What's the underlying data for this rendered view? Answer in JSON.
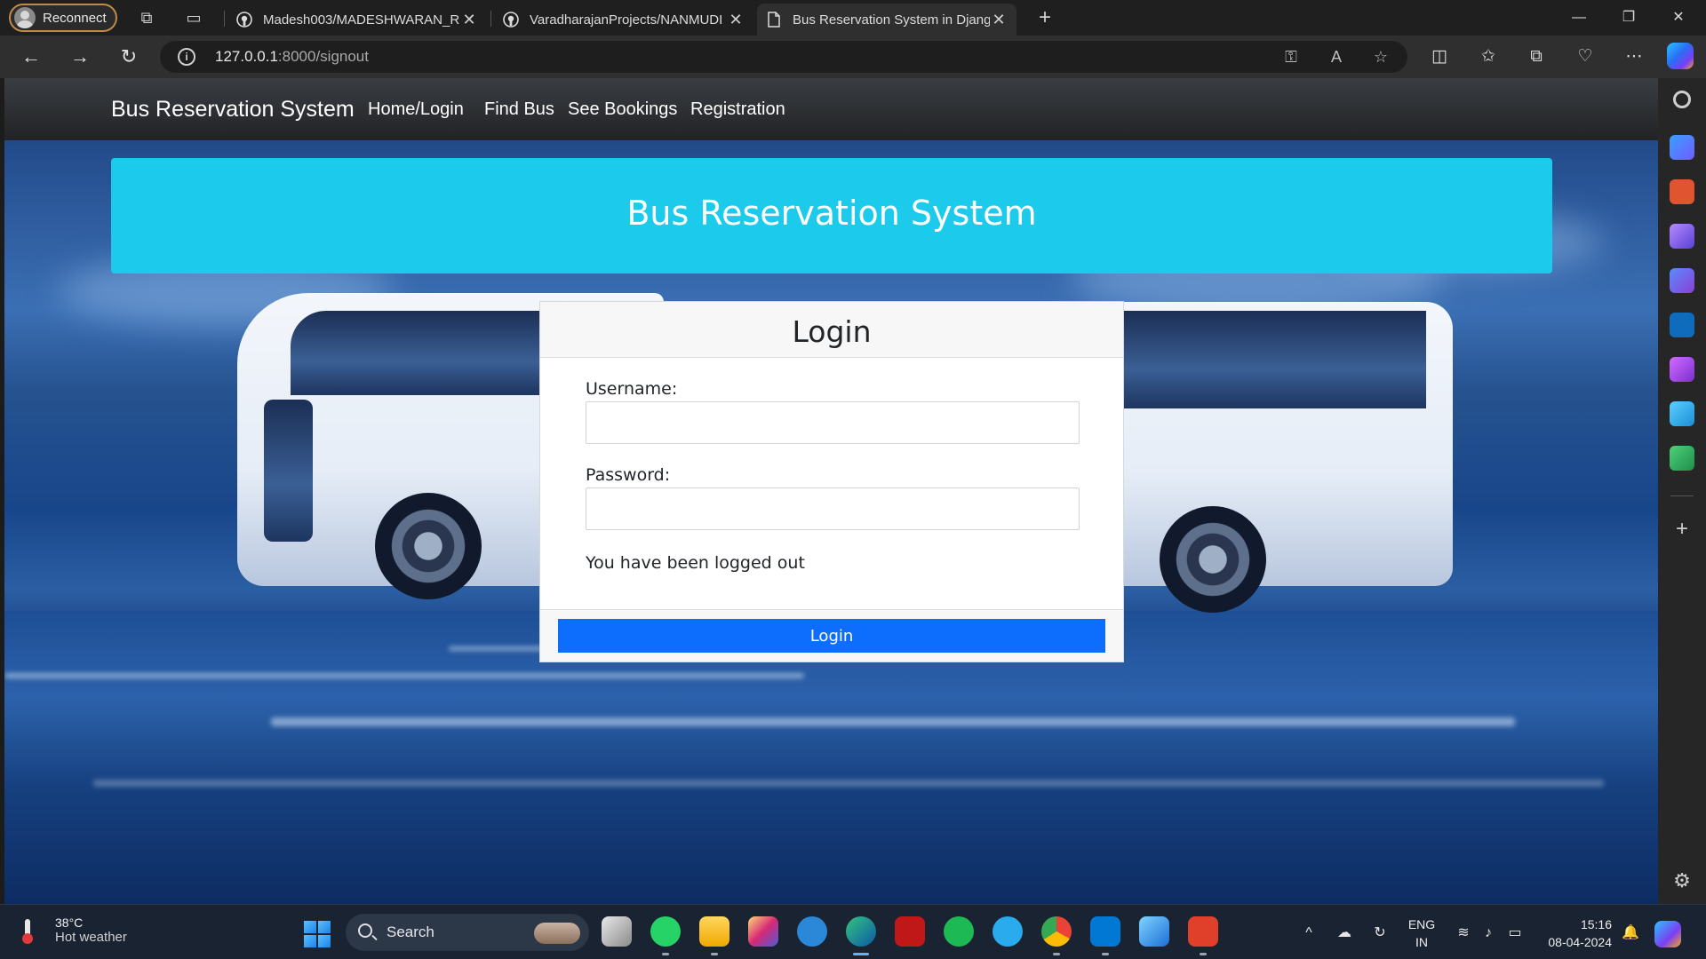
{
  "browser": {
    "profile_label": "Reconnect",
    "tabs": [
      {
        "title": "Madesh003/MADESHWARAN_R",
        "icon": "github-icon"
      },
      {
        "title": "VaradharajanProjects/NANMUDI",
        "icon": "github-icon"
      },
      {
        "title": "Bus Reservation System in Django",
        "icon": "document-icon",
        "active": true
      }
    ],
    "url_host": "127.0.0.1",
    "url_path": ":8000/signout"
  },
  "site": {
    "brand": "Bus Reservation System",
    "nav": [
      "Home/Login",
      "Find Bus",
      "See Bookings",
      "Registration"
    ],
    "banner_title": "Bus Reservation System"
  },
  "login": {
    "title": "Login",
    "username_label": "Username:",
    "username_value": "",
    "password_label": "Password:",
    "password_value": "",
    "message": "You have been logged out",
    "button_label": "Login",
    "button_color": "#0d6efd"
  },
  "taskbar": {
    "weather_temp": "38°C",
    "weather_desc": "Hot weather",
    "search_label": "Search",
    "lang_top": "ENG",
    "lang_bottom": "IN",
    "time": "15:16",
    "date": "08-04-2024"
  },
  "colors": {
    "banner": "#1ccaec",
    "navbar": "#212326",
    "accent": "#0d6efd"
  }
}
